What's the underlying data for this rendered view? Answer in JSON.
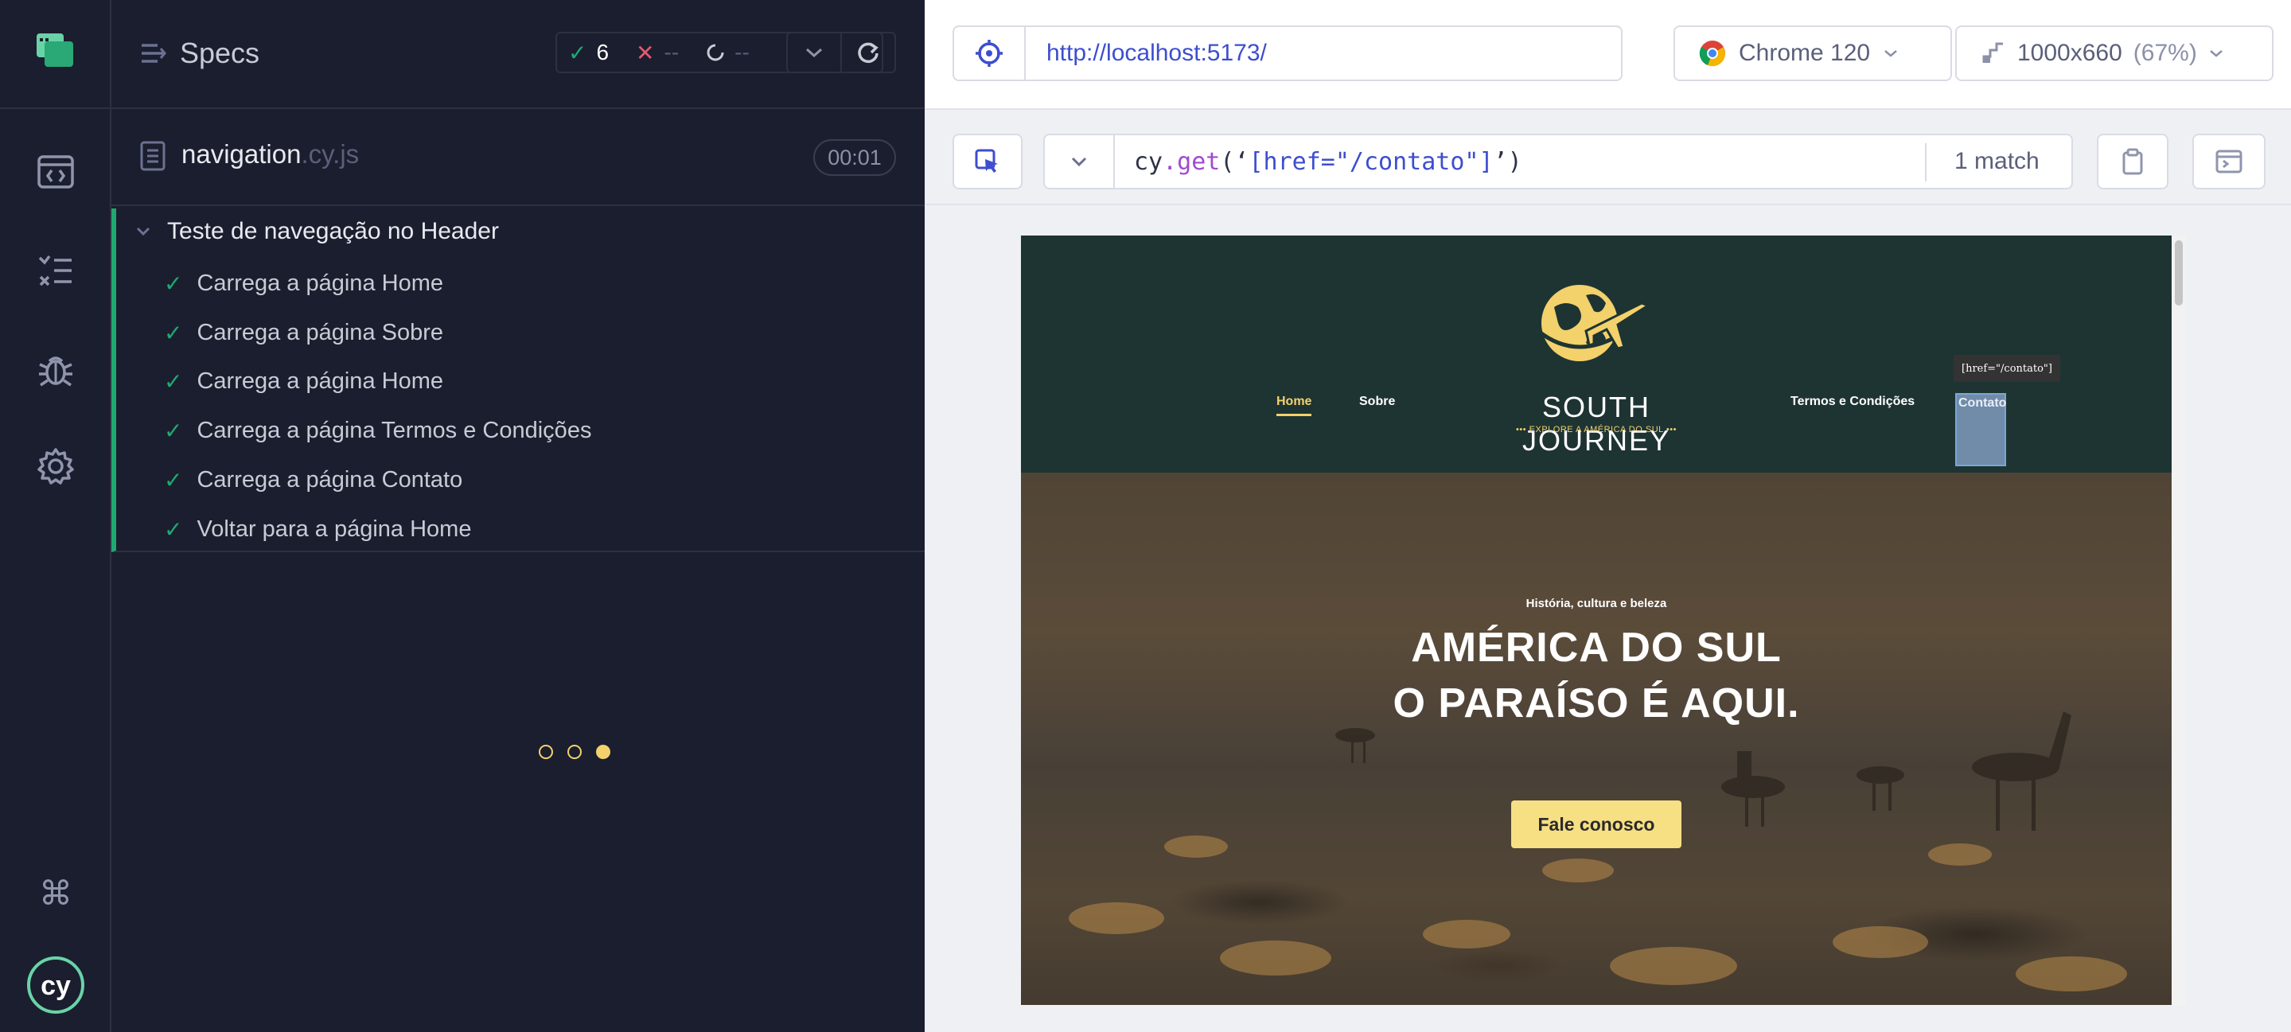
{
  "specs_panel": {
    "title": "Specs",
    "stats": {
      "passed": "6",
      "failed": "--",
      "pending": "--"
    },
    "spec_file": {
      "name": "navigation",
      "ext": ".cy.js",
      "duration": "00:01"
    },
    "suite": {
      "title": "Teste de navegação no Header",
      "tests": [
        "Carrega a página Home",
        "Carrega a página Sobre",
        "Carrega a página Home",
        "Carrega a página Termos e Condições",
        "Carrega a página Contato",
        "Voltar para a página Home"
      ]
    }
  },
  "runner": {
    "url": "http://localhost:5173/",
    "browser": "Chrome 120",
    "viewport": "1000x660",
    "viewport_scale": "(67%)",
    "selector": {
      "prefix": "cy",
      "fn": ".get",
      "open": "(‘",
      "arg": "[href=\"/contato\"]",
      "close": "’)",
      "matches": "1 match"
    }
  },
  "aut": {
    "nav": {
      "home": "Home",
      "sobre": "Sobre",
      "termos": "Termos e Condições",
      "contato": "Contato"
    },
    "brand": "SOUTH JOURNEY",
    "tagline": "••• EXPLORE A AMÉRICA DO SUL •••",
    "tooltip": "[href=\"/contato\"]",
    "hero": {
      "kicker": "História, cultura e beleza",
      "line1": "AMÉRICA DO SUL",
      "line2": "O PARAÍSO É AQUI.",
      "cta": "Fale conosco"
    }
  },
  "colors": {
    "pass": "#1fa971",
    "fail": "#e05a6f",
    "accent": "#f3d16b",
    "link": "#3d4ecf"
  }
}
